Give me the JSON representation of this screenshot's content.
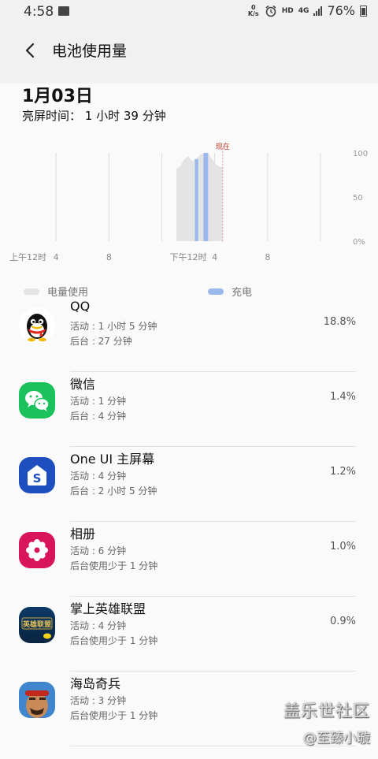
{
  "status_bar": {
    "time": "4:58",
    "net_speed_top": "0",
    "net_speed_bottom": "K/s",
    "hd": "HD",
    "network": "4G",
    "battery": "76%"
  },
  "app_bar": {
    "title": "电池使用量"
  },
  "summary": {
    "date": "1月03日",
    "screen_on_time": "亮屏时间： 1 小时 39 分钟"
  },
  "chart_data": {
    "type": "area",
    "x_tick_labels": [
      "上午12时",
      "4",
      "8",
      "下午12时",
      "4",
      "8"
    ],
    "x_ticks_hours": [
      0,
      4,
      8,
      12,
      16,
      20
    ],
    "x_range_hours": [
      0,
      24
    ],
    "y_tick_labels": [
      "100",
      "50",
      "0%"
    ],
    "y_range": [
      0,
      100
    ],
    "now_label": "现在",
    "now_hour": 16.6,
    "grid": true,
    "battery_level": [
      {
        "hour": 13.1,
        "level": 82
      },
      {
        "hour": 13.4,
        "level": 85
      },
      {
        "hour": 13.7,
        "level": 93
      },
      {
        "hour": 14.0,
        "level": 96
      },
      {
        "hour": 14.3,
        "level": 91
      },
      {
        "hour": 14.6,
        "level": 93
      },
      {
        "hour": 14.9,
        "level": 98
      },
      {
        "hour": 15.2,
        "level": 100
      },
      {
        "hour": 15.5,
        "level": 100
      },
      {
        "hour": 15.8,
        "level": 93
      },
      {
        "hour": 16.1,
        "level": 87
      },
      {
        "hour": 16.4,
        "level": 84
      },
      {
        "hour": 16.6,
        "level": 85
      }
    ],
    "charging_periods": [
      {
        "start": 14.5,
        "end": 14.75
      },
      {
        "start": 15.15,
        "end": 15.5
      }
    ],
    "legend": [
      {
        "label": "电量使用",
        "color": "#e4e4e4"
      },
      {
        "label": "充电",
        "color": "#9ab8ec"
      }
    ]
  },
  "apps": [
    {
      "name": "QQ",
      "active": "活动 : 1 小时 5 分钟",
      "background": "后台 : 27 分钟",
      "percent": "18.8%",
      "icon": "qq-icon"
    },
    {
      "name": "微信",
      "active": "活动 : 1 分钟",
      "background": "后台 : 4 分钟",
      "percent": "1.4%",
      "icon": "wechat-icon"
    },
    {
      "name": "One UI 主屏幕",
      "active": "活动 : 4 分钟",
      "background": "后台 : 2 小时 5 分钟",
      "percent": "1.2%",
      "icon": "one-ui-home-icon"
    },
    {
      "name": "相册",
      "active": "活动 : 6 分钟",
      "background": "后台使用少于 1 分钟",
      "percent": "1.0%",
      "icon": "gallery-flower-icon"
    },
    {
      "name": "掌上英雄联盟",
      "active": "活动 : 4 分钟",
      "background": "后台使用少于 1 分钟",
      "percent": "0.9%",
      "icon": "lol-icon",
      "icon_text": "英雄联盟"
    },
    {
      "name": "海岛奇兵",
      "active": "活动 : 3 分钟",
      "background": "后台使用少于 1 分钟",
      "percent": "",
      "icon": "boom-beach-icon"
    }
  ],
  "watermark": {
    "line1": "盖乐世社区",
    "line2": "@至臻小璇"
  }
}
